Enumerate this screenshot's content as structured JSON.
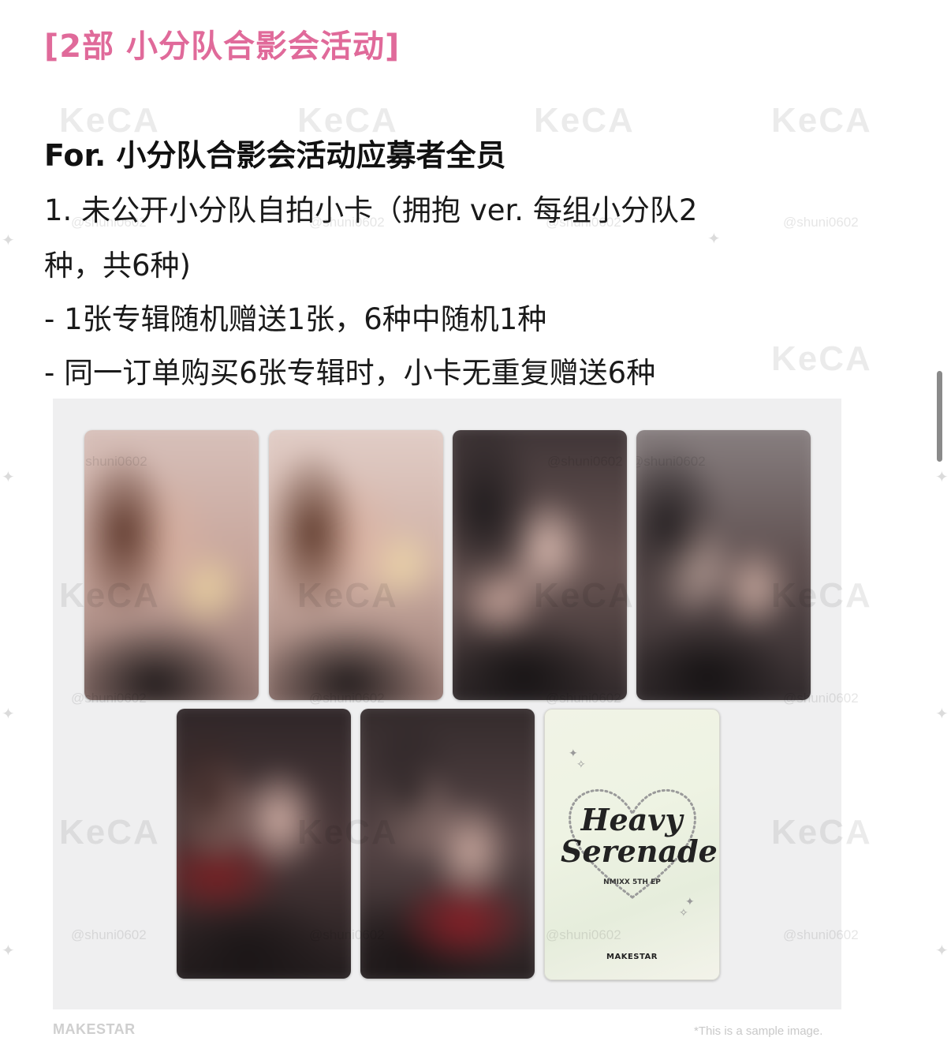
{
  "post": {
    "heading": "[2部 小分队合影会活动]",
    "for_line": "For. 小分队合影会活动应募者全员",
    "lines": [
      "1. 未公开小分队自拍小卡（拥抱 ver. 每组小分队2",
      "种，共6种)",
      "- 1张专辑随机赠送1张，6种中随机1种",
      "- 同一订单购买6张专辑时，小卡无重复赠送6种"
    ]
  },
  "album_card": {
    "title_line1": "Heavy",
    "title_line2": "Serenade",
    "subtitle": "NMIXX 5TH EP",
    "brand": "MAKESTAR"
  },
  "watermarks": {
    "keca": "KeCA",
    "handle": "@shuni0602"
  },
  "footer": {
    "brand": "MAKESTAR",
    "note": "*This is a sample image."
  },
  "colors": {
    "heading": "#e06a9a",
    "panel": "#efeff0"
  }
}
